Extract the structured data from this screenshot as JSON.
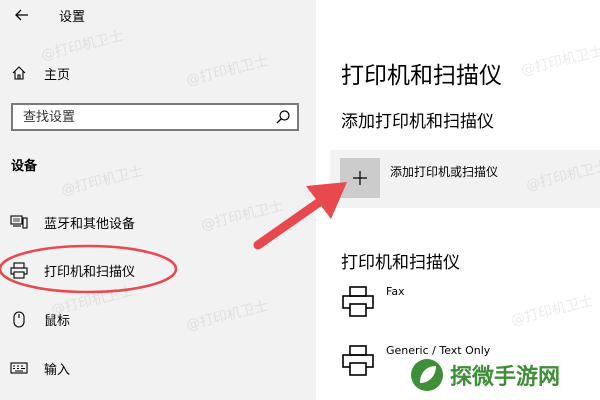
{
  "window": {
    "title": "设置",
    "back_icon": "back-arrow-icon"
  },
  "sidebar": {
    "home": {
      "label": "主页",
      "icon": "home-icon"
    },
    "search": {
      "placeholder": "查找设置",
      "icon": "search-icon"
    },
    "section": "设备",
    "items": [
      {
        "label": "蓝牙和其他设备",
        "icon": "bluetooth-devices-icon"
      },
      {
        "label": "打印机和扫描仪",
        "icon": "printer-icon",
        "highlighted": true
      },
      {
        "label": "鼠标",
        "icon": "mouse-icon"
      },
      {
        "label": "输入",
        "icon": "keyboard-icon"
      }
    ]
  },
  "main": {
    "title": "打印机和扫描仪",
    "add_section_title": "添加打印机和扫描仪",
    "add_button_label": "添加打印机或扫描仪",
    "list_title": "打印机和扫描仪",
    "printers": [
      {
        "name": "Fax",
        "icon": "printer-icon"
      },
      {
        "name": "Generic / Text Only",
        "icon": "printer-icon"
      }
    ]
  },
  "annotation": {
    "highlight_color": "#e8494f",
    "arrow_color": "#e8494f"
  },
  "watermark_text": "@打印机卫士",
  "brand": {
    "text": "探微手游网",
    "color": "#3f8f38"
  }
}
